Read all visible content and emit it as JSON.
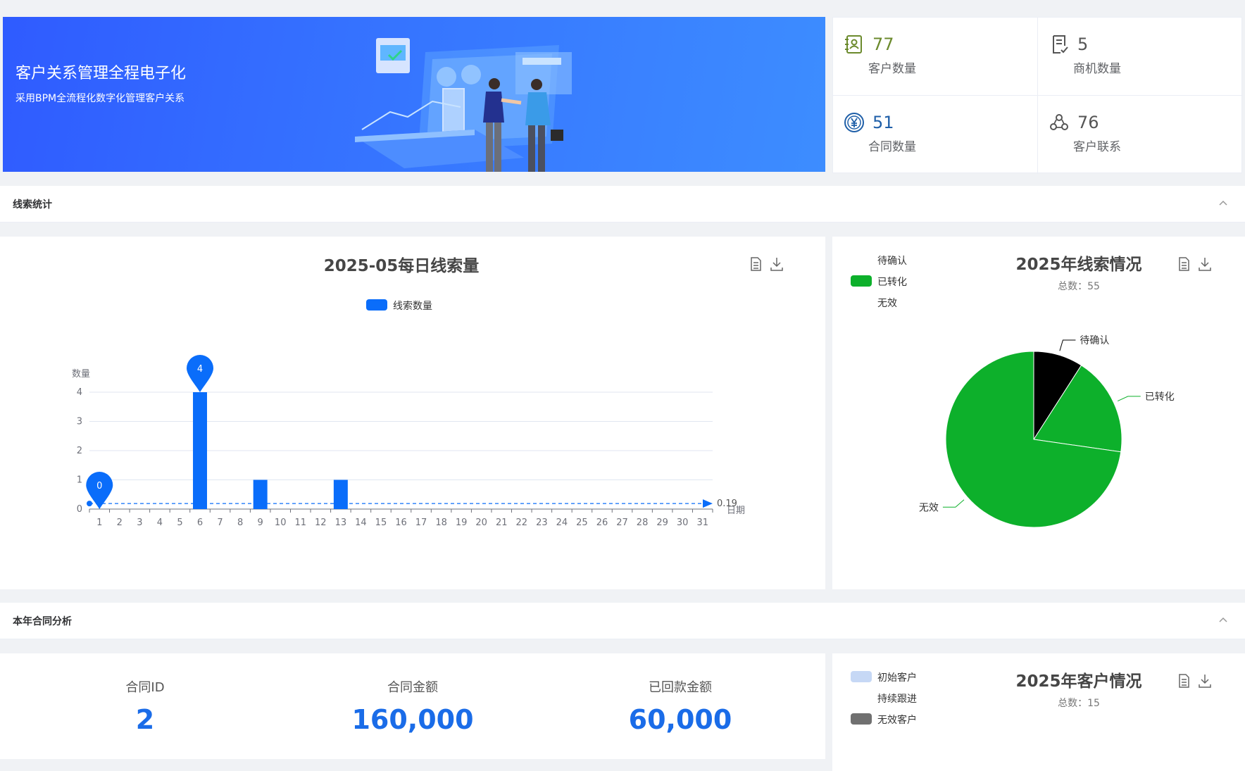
{
  "banner": {
    "title": "客户关系管理全程电子化",
    "subtitle": "采用BPM全流程化数字化管理客户关系"
  },
  "stats": [
    {
      "value": "77",
      "label": "客户数量",
      "icon": "contact-book-icon",
      "color": "#6b8a2c"
    },
    {
      "value": "5",
      "label": "商机数量",
      "icon": "document-check-icon",
      "color": "#555555"
    },
    {
      "value": "51",
      "label": "合同数量",
      "icon": "yuan-coin-icon",
      "color": "#1f5fa8"
    },
    {
      "value": "76",
      "label": "客户联系",
      "icon": "people-network-icon",
      "color": "#555555"
    }
  ],
  "sections": {
    "leads": "线索统计",
    "contracts": "本年合同分析"
  },
  "icons": {
    "collapse": "chevron-up-icon",
    "view_data": "data-view-icon",
    "download": "download-icon"
  },
  "contract_metrics": [
    {
      "label": "合同ID",
      "value": "2"
    },
    {
      "label": "合同金额",
      "value": "160,000"
    },
    {
      "label": "已回款金额",
      "value": "60,000"
    }
  ],
  "chart_data": [
    {
      "type": "bar",
      "title": "2025-05每日线索量",
      "xlabel": "日期",
      "ylabel": "数量",
      "categories": [
        "1",
        "2",
        "3",
        "4",
        "5",
        "6",
        "7",
        "8",
        "9",
        "10",
        "11",
        "12",
        "13",
        "14",
        "15",
        "16",
        "17",
        "18",
        "19",
        "20",
        "21",
        "22",
        "23",
        "24",
        "25",
        "26",
        "27",
        "28",
        "29",
        "30",
        "31"
      ],
      "series": [
        {
          "name": "线索数量",
          "color": "#0a6dfa",
          "values": [
            0,
            0,
            0,
            0,
            0,
            4,
            0,
            0,
            1,
            0,
            0,
            0,
            1,
            0,
            0,
            0,
            0,
            0,
            0,
            0,
            0,
            0,
            0,
            0,
            0,
            0,
            0,
            0,
            0,
            0,
            0
          ]
        }
      ],
      "ylim": [
        0,
        4
      ],
      "yticks": [
        "0",
        "1",
        "2",
        "3",
        "4"
      ],
      "mark_points": [
        {
          "label": "4",
          "category": "6",
          "value": 4
        },
        {
          "label": "0",
          "category": "1",
          "value": 0
        }
      ],
      "mark_line": {
        "label": "0.19",
        "value": 0.19
      },
      "grid": true,
      "legend": "top-center"
    },
    {
      "type": "pie",
      "title": "2025年线索情况",
      "subtitle": "总数：55",
      "legend": "top-left",
      "slices": [
        {
          "name": "待确认",
          "value": 5,
          "color": "#000000"
        },
        {
          "name": "已转化",
          "value": 10,
          "color": "#0db02b"
        },
        {
          "name": "无效",
          "value": 40,
          "color": "#0db02b"
        }
      ]
    },
    {
      "type": "pie",
      "title": "2025年客户情况",
      "subtitle": "总数：15",
      "legend": "top-left",
      "slices": [
        {
          "name": "初始客户",
          "color": "#c6d8f5"
        },
        {
          "name": "持续跟进",
          "color": "#ffffff"
        },
        {
          "name": "无效客户",
          "color": "#707070"
        }
      ]
    }
  ]
}
